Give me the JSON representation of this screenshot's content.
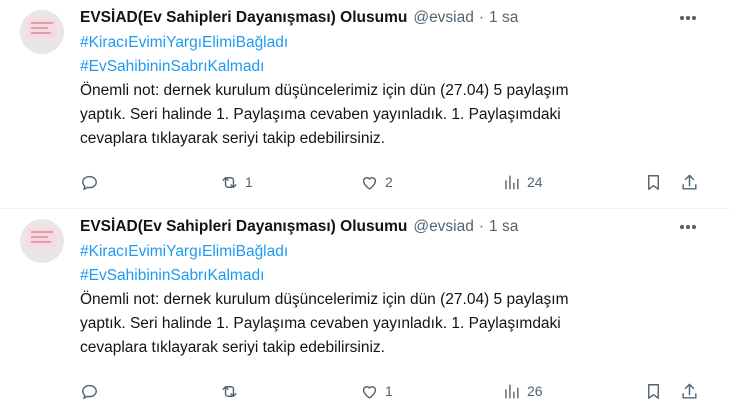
{
  "tweets": [
    {
      "author_name": "EVSİAD(Ev Sahipleri Dayanışması) Olusumu",
      "handle": "@evsiad",
      "separator": "·",
      "time": "1 sa",
      "hashtags": [
        "#KiracıEvimiYargıElimiBağladı",
        "#EvSahibininSabrıKalmadı"
      ],
      "text": "Önemli not: dernek kurulum düşüncelerimiz için dün (27.04) 5 paylaşım\nyaptık. Seri halinde 1. Paylaşıma cevaben yayınladık. 1. Paylaşımdaki\ncevaplara tıklayarak seriyi takip edebilirsiniz.",
      "stats": {
        "replies": "",
        "retweets": "1",
        "likes": "2",
        "views": "24"
      }
    },
    {
      "author_name": "EVSİAD(Ev Sahipleri Dayanışması) Olusumu",
      "handle": "@evsiad",
      "separator": "·",
      "time": "1 sa",
      "hashtags": [
        "#KiracıEvimiYargıElimiBağladı",
        "#EvSahibininSabrıKalmadı"
      ],
      "text": "Önemli not: dernek kurulum düşüncelerimiz için dün (27.04) 5 paylaşım\nyaptık. Seri halinde 1. Paylaşıma cevaben yayınladık. 1. Paylaşımdaki\ncevaplara tıklayarak seriyi takip edebilirsiniz.",
      "stats": {
        "replies": "",
        "retweets": "",
        "likes": "1",
        "views": "26"
      }
    }
  ],
  "icons": {
    "reply": "reply-icon",
    "retweet": "retweet-icon",
    "like": "heart-icon",
    "views": "views-icon",
    "bookmark": "bookmark-icon",
    "share": "share-icon",
    "more": "more-icon"
  },
  "colors": {
    "accent": "#1d9bf0",
    "text": "#0f1419",
    "muted": "#536471"
  }
}
